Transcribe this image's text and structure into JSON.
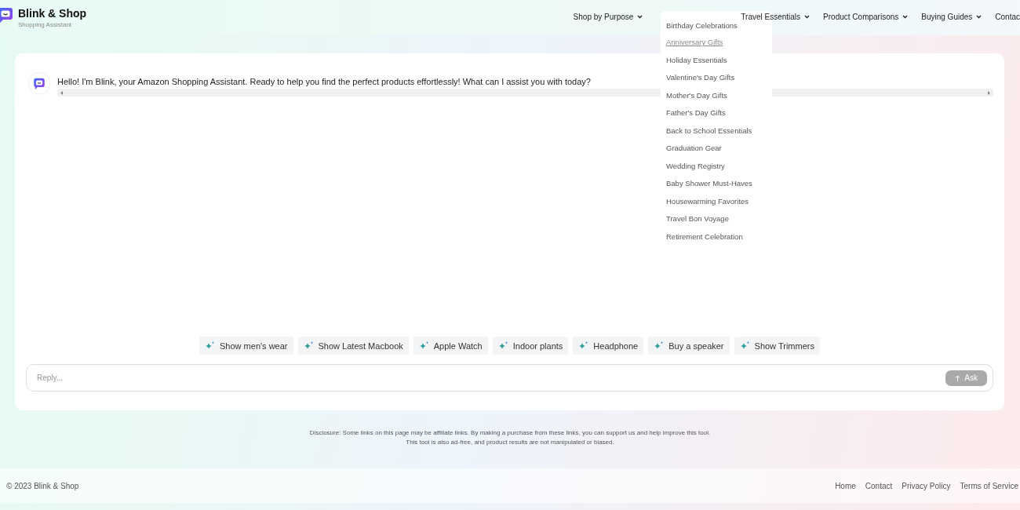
{
  "brand": {
    "name": "Blink & Shop",
    "tagline": "Shopping Assistant"
  },
  "nav": [
    {
      "label": "Shop by Purpose",
      "caret": true
    },
    {
      "label": "Travel Essentials",
      "caret": true
    },
    {
      "label": "Product Comparisons",
      "caret": true
    },
    {
      "label": "Buying Guides",
      "caret": true
    },
    {
      "label": "Contac",
      "caret": false
    }
  ],
  "dropdown": [
    {
      "label": "Birthday Celebrations",
      "hovered": false
    },
    {
      "label": "Anniversary Gifts",
      "hovered": true
    },
    {
      "label": "Holiday Essentials",
      "hovered": false
    },
    {
      "label": "Valentine's Day Gifts",
      "hovered": false
    },
    {
      "label": "Mother's Day Gifts",
      "hovered": false
    },
    {
      "label": "Father's Day Gifts",
      "hovered": false
    },
    {
      "label": "Back to School Essentials",
      "hovered": false
    },
    {
      "label": "Graduation Gear",
      "hovered": false
    },
    {
      "label": "Wedding Registry",
      "hovered": false
    },
    {
      "label": "Baby Shower Must-Haves",
      "hovered": false
    },
    {
      "label": "Housewarming Favorites",
      "hovered": false
    },
    {
      "label": "Travel Bon Voyage",
      "hovered": false
    },
    {
      "label": "Retirement Celebration",
      "hovered": false
    }
  ],
  "chat": {
    "message": "Hello! I'm Blink, your Amazon Shopping Assistant. Ready to help you find the perfect products effortlessly! What can I assist you with today?"
  },
  "suggestions": [
    "Show men's wear",
    "Show Latest Macbook",
    "Apple Watch",
    "Indoor plants",
    "Headphone",
    "Buy a speaker",
    "Show Trimmers"
  ],
  "reply": {
    "placeholder": "Reply...",
    "button": "Ask",
    "disabled": true
  },
  "disclosure": [
    "Disclosure: Some links on this page may be affiliate links. By making a purchase from these links, you can support us and help improve this tool.",
    "This tool is also ad-free, and product results are not manipulated or biased."
  ],
  "footer": {
    "copyright": "© 2023 Blink & Shop",
    "links": [
      "Home",
      "Contact",
      "Privacy Policy",
      "Terms of Service"
    ]
  }
}
